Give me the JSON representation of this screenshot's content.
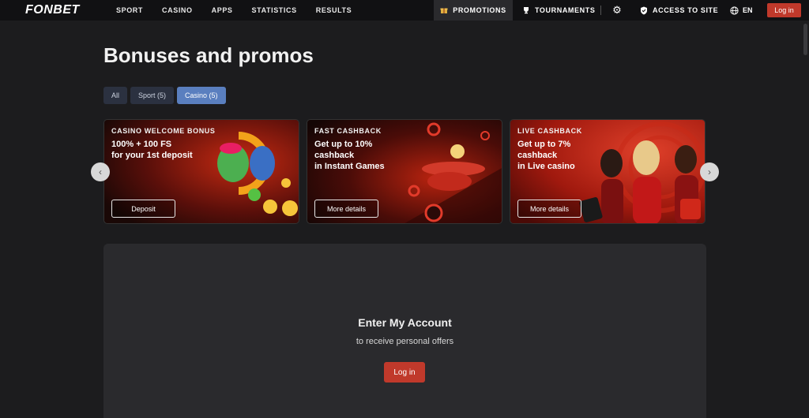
{
  "header": {
    "logo": "FONBET",
    "nav": [
      "SPORT",
      "CASINO",
      "APPS",
      "STATISTICS",
      "RESULTS"
    ],
    "promotions": "PROMOTIONS",
    "tournaments": "TOURNAMENTS",
    "access": "ACCESS TO SITE",
    "lang": "EN",
    "login": "Log in"
  },
  "page": {
    "title": "Bonuses and promos",
    "filters": [
      "All",
      "Sport (5)",
      "Casino (5)"
    ],
    "active_filter": "Casino (5)"
  },
  "cards": [
    {
      "kicker": "CASINO WELCOME BONUS",
      "headline": "100% + 100 FS\nfor your 1st deposit",
      "cta": "Deposit"
    },
    {
      "kicker": "FAST CASHBACK",
      "headline": "Get up to 10%\ncashback\nin Instant Games",
      "cta": "More details"
    },
    {
      "kicker": "LIVE CASHBACK",
      "headline": "Get up to 7%\ncashback\nin Live casino",
      "cta": "More details"
    }
  ],
  "account": {
    "heading": "Enter My Account",
    "subtext": "to receive personal offers",
    "button": "Log in"
  },
  "colors": {
    "brand_red": "#c0392b",
    "active_chip": "#5a7fbf",
    "panel": "#2a2a2d"
  }
}
